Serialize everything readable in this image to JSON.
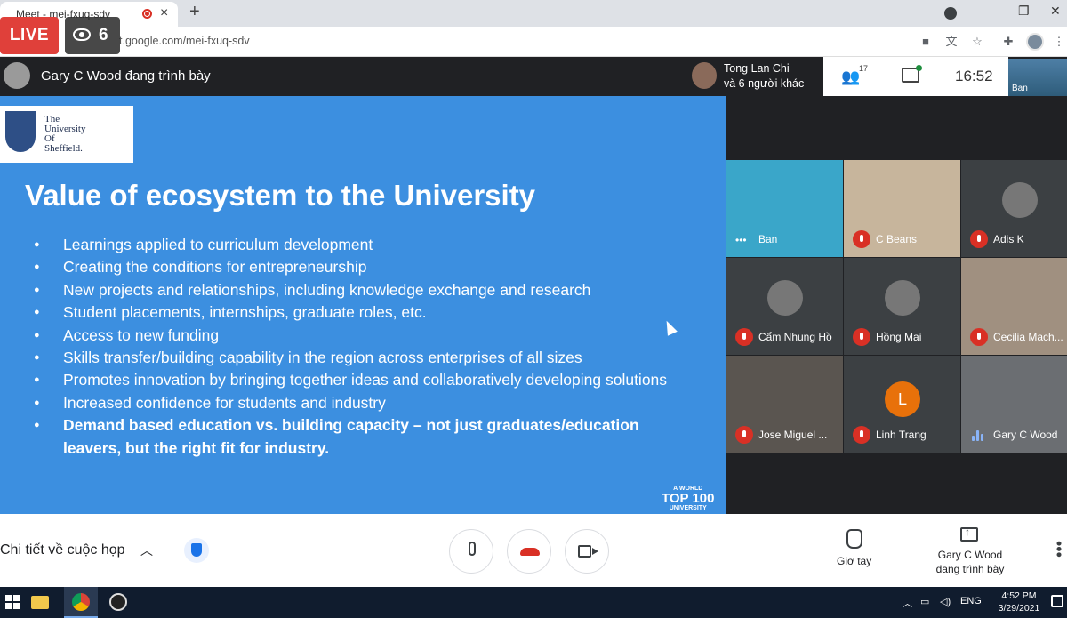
{
  "browser": {
    "tab_title": "Meet - mei-fxuq-sdv",
    "url": "meet.google.com/mei-fxuq-sdv",
    "url_visible": "t.google.com/mei-fxuq-sdv"
  },
  "stream": {
    "live_label": "LIVE",
    "viewer_count": "6"
  },
  "meet": {
    "presenter_label": "Gary C Wood đang trình bày",
    "raised_name": "Tong Lan Chi",
    "raised_others": "và 6 người khác",
    "people_count": "17",
    "clock": "16:52",
    "self_name": "Ban"
  },
  "slide": {
    "logo_lines": [
      "The",
      "University",
      "Of",
      "Sheffield."
    ],
    "title": "Value of ecosystem to the University",
    "bullets": [
      "Learnings applied to curriculum development",
      "Creating the conditions for entrepreneurship",
      "New projects and relationships, including knowledge exchange and research",
      "Student placements, internships, graduate roles, etc.",
      "Access to new funding",
      "Skills transfer/building capability in the region across enterprises of all sizes",
      "Promotes innovation by bringing together ideas and collaboratively developing solutions",
      "Increased confidence for students and industry",
      "Demand based education vs. building capacity – not just graduates/education leavers, but the right fit for industry."
    ],
    "badge_small": "A WORLD",
    "badge_main": "TOP 100",
    "badge_sub": "UNIVERSITY"
  },
  "participants": [
    {
      "name": "Ban",
      "type": "video",
      "status": "dots",
      "color": "#3aa6c9"
    },
    {
      "name": "C Beans",
      "type": "video",
      "status": "muted",
      "color": "#c7b59c"
    },
    {
      "name": "Adis K",
      "type": "avatar",
      "status": "muted",
      "color": "#3c4043"
    },
    {
      "name": "Cẩm Nhung Hồ",
      "type": "avatar",
      "status": "muted",
      "color": "#3c4043"
    },
    {
      "name": "Hồng Mai",
      "type": "avatar",
      "status": "muted",
      "color": "#3c4043"
    },
    {
      "name": "Cecilia Mach...",
      "type": "video",
      "status": "muted",
      "color": "#a09080"
    },
    {
      "name": "Jose Miguel ...",
      "type": "video",
      "status": "muted",
      "color": "#5a5550"
    },
    {
      "name": "Linh Trang",
      "type": "letter",
      "letter": "L",
      "status": "muted",
      "color": "#3c4043"
    },
    {
      "name": "Gary C Wood",
      "type": "video",
      "status": "speaking",
      "color": "#6b6e72"
    }
  ],
  "bottom": {
    "details_label": "Chi tiết về cuộc họp",
    "raise_hand_label": "Giơ tay",
    "present_line1": "Gary C Wood",
    "present_line2": "đang trình bày"
  },
  "taskbar": {
    "language": "ENG",
    "time": "4:52 PM",
    "date": "3/29/2021"
  },
  "colors": {
    "slide_bg": "#3c8fe0",
    "live_red": "#e0403a",
    "meet_dark": "#202124",
    "hangup_red": "#d93025"
  }
}
